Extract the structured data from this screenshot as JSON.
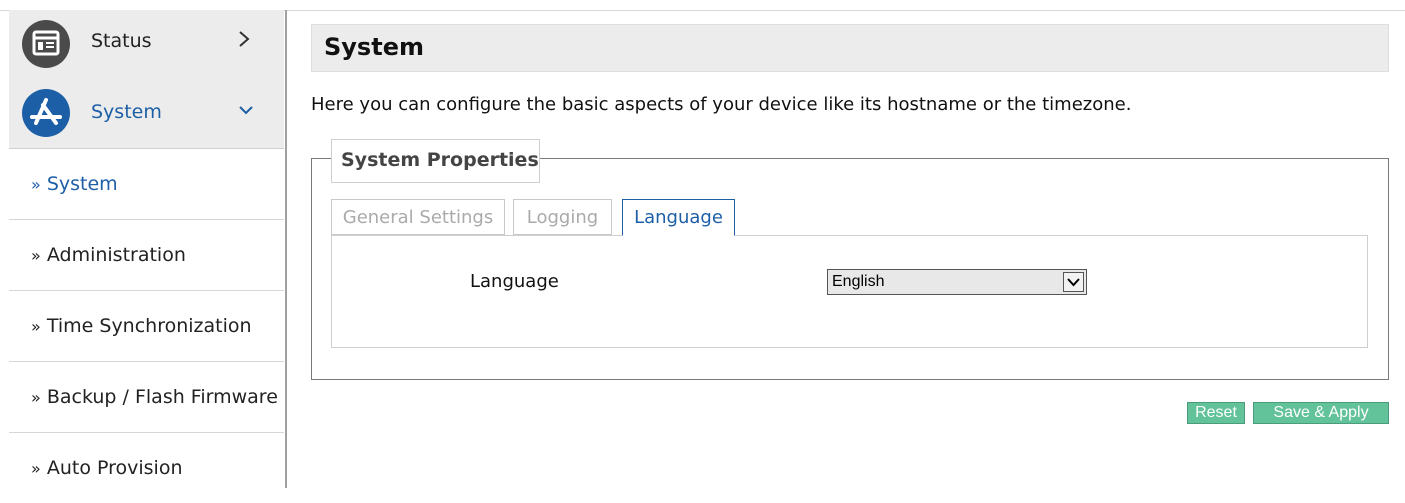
{
  "sidebar": {
    "status": {
      "label": "Status",
      "icon": "status-panel-icon",
      "chevron": "chevron-right-icon"
    },
    "system": {
      "label": "System",
      "icon": "app-store-icon",
      "chevron": "chevron-down-icon"
    },
    "sub_prefix": "»",
    "items": [
      {
        "label": "System",
        "active": true
      },
      {
        "label": "Administration"
      },
      {
        "label": "Time Synchronization"
      },
      {
        "label": "Backup / Flash Firmware"
      },
      {
        "label": "Auto Provision"
      }
    ]
  },
  "header": {
    "title": "System"
  },
  "description": "Here you can configure the basic aspects of your device like its hostname or the timezone.",
  "section": {
    "legend": "System Properties",
    "tabs": [
      {
        "label": "General Settings"
      },
      {
        "label": "Logging"
      },
      {
        "label": "Language",
        "active": true
      }
    ],
    "language_field": {
      "label": "Language",
      "value": "English"
    }
  },
  "buttons": {
    "reset": "Reset",
    "save_apply": "Save & Apply"
  },
  "colors": {
    "accent": "#1d5fa6",
    "button_green": "#62c29a",
    "sidebar_bg": "#ececec"
  }
}
